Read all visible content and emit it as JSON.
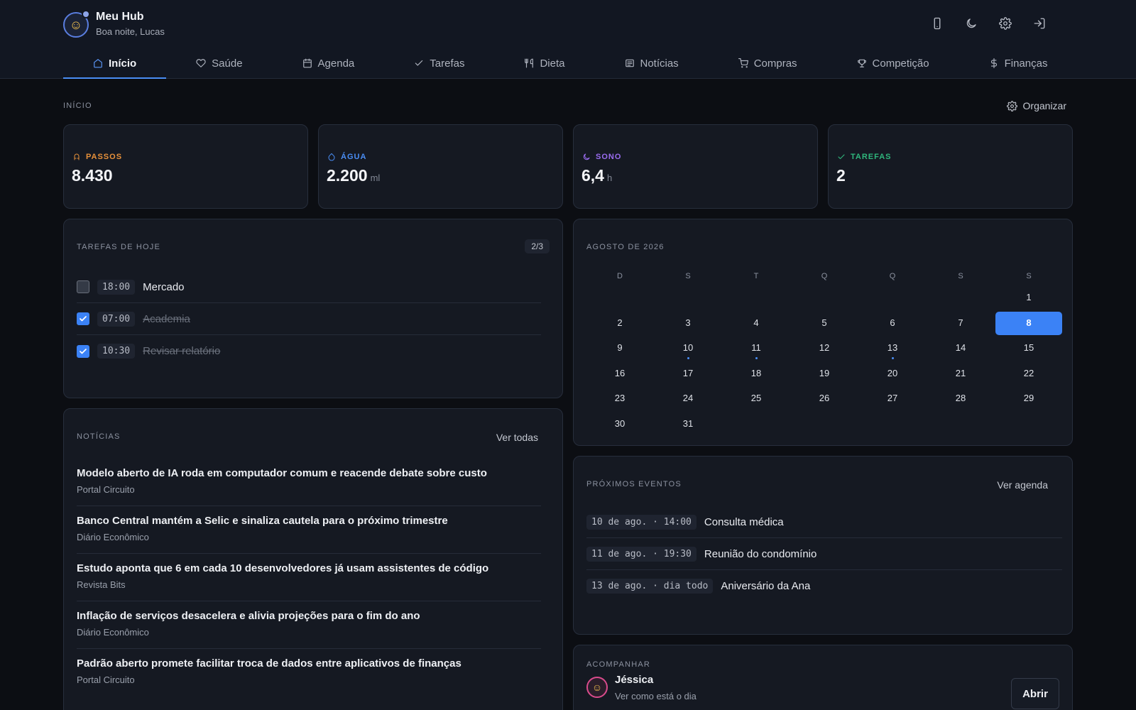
{
  "header": {
    "app_title": "Meu Hub",
    "greeting": "Boa noite, Lucas",
    "actions": [
      {
        "name": "phone-icon"
      },
      {
        "name": "moon-icon"
      },
      {
        "name": "gear-icon"
      },
      {
        "name": "logout-icon"
      }
    ]
  },
  "tabs": [
    {
      "label": "Início",
      "icon": "home-icon",
      "active": true
    },
    {
      "label": "Saúde",
      "icon": "heart-icon"
    },
    {
      "label": "Agenda",
      "icon": "calendar-icon"
    },
    {
      "label": "Tarefas",
      "icon": "check-icon"
    },
    {
      "label": "Dieta",
      "icon": "utensils-icon"
    },
    {
      "label": "Notícias",
      "icon": "newspaper-icon"
    },
    {
      "label": "Compras",
      "icon": "cart-icon"
    },
    {
      "label": "Competição",
      "icon": "trophy-icon"
    },
    {
      "label": "Finanças",
      "icon": "dollar-icon"
    }
  ],
  "page": {
    "section_label": "INÍCIO",
    "organize_label": "Organizar"
  },
  "stats": [
    {
      "label": "PASSOS",
      "value": "8.430",
      "unit": "",
      "color": "#e8913a",
      "icon": "footsteps-icon"
    },
    {
      "label": "ÁGUA",
      "value": "2.200",
      "unit": "ml",
      "color": "#4a8ef5",
      "icon": "droplet-icon"
    },
    {
      "label": "SONO",
      "value": "6,4",
      "unit": "h",
      "color": "#9a6cf0",
      "icon": "moon-icon"
    },
    {
      "label": "TAREFAS",
      "value": "2",
      "unit": "",
      "color": "#2fb67c",
      "icon": "check-icon"
    }
  ],
  "tasks": {
    "title": "TAREFAS DE HOJE",
    "counter": "2/3",
    "items": [
      {
        "time": "18:00",
        "text": "Mercado",
        "done": false
      },
      {
        "time": "07:00",
        "text": "Academia",
        "done": true
      },
      {
        "time": "10:30",
        "text": "Revisar relatório",
        "done": true
      }
    ]
  },
  "news": {
    "title": "NOTÍCIAS",
    "link": "Ver todas",
    "items": [
      {
        "title": "Modelo aberto de IA roda em computador comum e reacende debate sobre custo",
        "source": "Portal Circuito"
      },
      {
        "title": "Banco Central mantém a Selic e sinaliza cautela para o próximo trimestre",
        "source": "Diário Econômico"
      },
      {
        "title": "Estudo aponta que 6 em cada 10 desenvolvedores já usam assistentes de código",
        "source": "Revista Bits"
      },
      {
        "title": "Inflação de serviços desacelera e alivia projeções para o fim do ano",
        "source": "Diário Econômico"
      },
      {
        "title": "Padrão aberto promete facilitar troca de dados entre aplicativos de finanças",
        "source": "Portal Circuito"
      }
    ]
  },
  "calendar": {
    "title": "AGOSTO DE 2026",
    "weekdays": [
      "D",
      "S",
      "T",
      "Q",
      "Q",
      "S",
      "S"
    ],
    "weeks": [
      [
        "",
        "",
        "",
        "",
        "",
        "",
        "1"
      ],
      [
        "2",
        "3",
        "4",
        "5",
        "6",
        "7",
        "8"
      ],
      [
        "9",
        "10",
        "11",
        "12",
        "13",
        "14",
        "15"
      ],
      [
        "16",
        "17",
        "18",
        "19",
        "20",
        "21",
        "22"
      ],
      [
        "23",
        "24",
        "25",
        "26",
        "27",
        "28",
        "29"
      ],
      [
        "30",
        "31",
        "",
        "",
        "",
        "",
        ""
      ]
    ],
    "today": "8",
    "event_days": [
      "10",
      "11",
      "13"
    ]
  },
  "events": {
    "title": "PRÓXIMOS EVENTOS",
    "link": "Ver agenda",
    "items": [
      {
        "when": "10 de ago. · 14:00",
        "text": "Consulta médica"
      },
      {
        "when": "11 de ago. · 19:30",
        "text": "Reunião do condomínio"
      },
      {
        "when": "13 de ago. · dia todo",
        "text": "Aniversário da Ana"
      }
    ]
  },
  "follow": {
    "title": "ACOMPANHAR",
    "name": "Jéssica",
    "subtitle": "Ver como está o dia",
    "button": "Abrir"
  }
}
